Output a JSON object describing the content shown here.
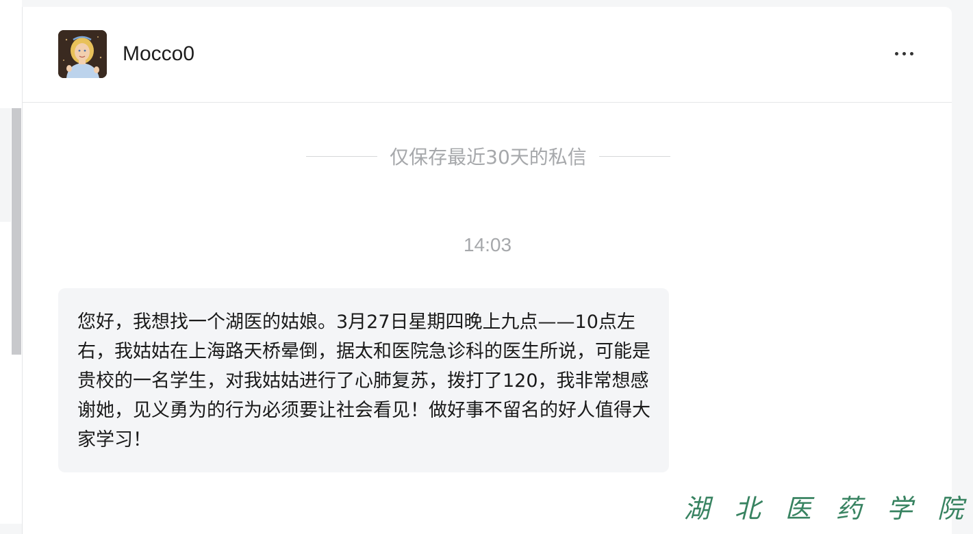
{
  "contact": {
    "name": "Mocco0"
  },
  "notice": "仅保存最近30天的私信",
  "conversation": {
    "timestamp": "14:03",
    "messages": [
      {
        "text": "您好，我想找一个湖医的姑娘。3月27日星期四晚上九点——10点左右，我姑姑在上海路天桥晕倒，据太和医院急诊科的医生所说，可能是贵校的一名学生，对我姑姑进行了心肺复苏，拨打了120，我非常想感谢她，见义勇为的行为必须要让社会看见！做好事不留名的好人值得大家学习！"
      }
    ]
  },
  "watermark": "湖北医药学院",
  "icons": {
    "more": "more-horizontal-icon",
    "avatar": "user-avatar-image"
  },
  "colors": {
    "bubble_bg": "#f4f5f7",
    "muted_text": "#a6a8ab",
    "watermark": "#2e7d59"
  }
}
